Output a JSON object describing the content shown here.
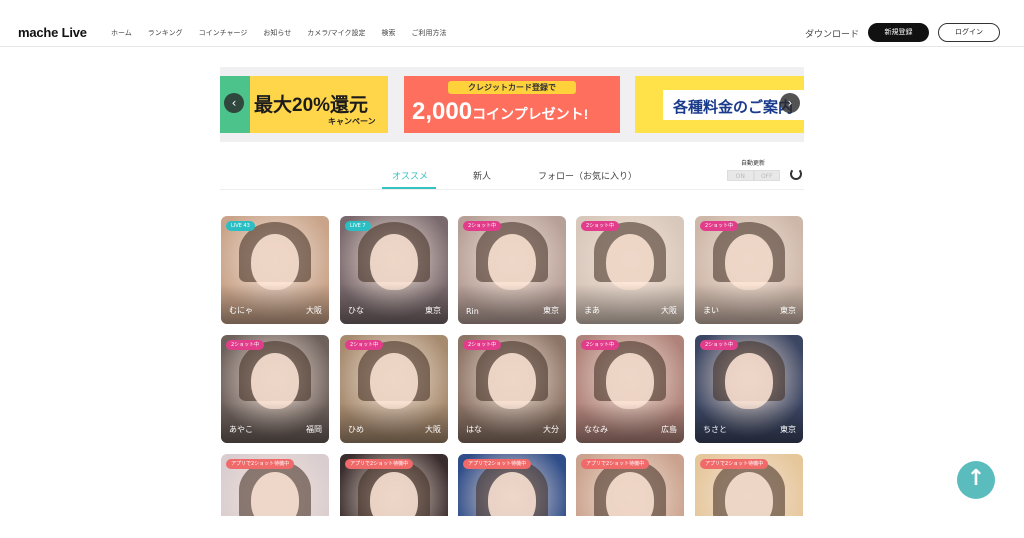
{
  "header": {
    "logo": "mache Live",
    "nav": [
      "ホーム",
      "ランキング",
      "コインチャージ",
      "お知らせ",
      "カメラ/マイク設定",
      "検索",
      "ご利用方法"
    ],
    "download": "ダウンロード",
    "register": "新規登録",
    "login": "ログイン"
  },
  "carousel": {
    "banner1": {
      "text": "最大20%還元",
      "sub": "キャンペーン"
    },
    "banner2": {
      "top": "クレジットカード登録で",
      "main": "2,000",
      "main_unit": "コイン",
      "main_rest": "プレゼント!"
    },
    "banner3": {
      "text": "各種料金のご案内"
    },
    "prev": "‹",
    "next": "›"
  },
  "tabs": [
    "オススメ",
    "新人",
    "フォロー（お気に入り）"
  ],
  "auto_refresh": {
    "label": "自動更新",
    "on": "ON",
    "off": "OFF"
  },
  "cards": [
    {
      "badge": "LIVE  43",
      "name": "むにゃ",
      "loc": "大阪",
      "badge_type": "teal",
      "color": "#c9a48a"
    },
    {
      "badge": "LIVE  7",
      "name": "ひな",
      "loc": "東京",
      "badge_type": "teal",
      "color": "#7a6a6e"
    },
    {
      "badge": "2ショット中",
      "name": "Rin",
      "loc": "東京",
      "badge_type": "pink",
      "color": "#b7a098"
    },
    {
      "badge": "2ショット中",
      "name": "まあ",
      "loc": "大阪",
      "badge_type": "pink",
      "color": "#d8c7bb"
    },
    {
      "badge": "2ショット中",
      "name": "まい",
      "loc": "東京",
      "badge_type": "pink",
      "color": "#cdb7a9"
    },
    {
      "badge": "2ショット中",
      "name": "あやこ",
      "loc": "福岡",
      "badge_type": "pink",
      "color": "#6e615c"
    },
    {
      "badge": "2ショット中",
      "name": "ひめ",
      "loc": "大阪",
      "badge_type": "pink",
      "color": "#a78b6f"
    },
    {
      "badge": "2ショット中",
      "name": "はな",
      "loc": "大分",
      "badge_type": "pink",
      "color": "#8c7466"
    },
    {
      "badge": "2ショット中",
      "name": "ななみ",
      "loc": "広島",
      "badge_type": "pink",
      "color": "#b0837a"
    },
    {
      "badge": "2ショット中",
      "name": "ちさと",
      "loc": "東京",
      "badge_type": "pink",
      "color": "#3b4663"
    },
    {
      "badge": "アプリで2ショット待機中",
      "name": "",
      "loc": "",
      "badge_type": "orange",
      "color": "#d9cdd0"
    },
    {
      "badge": "アプリで2ショット待機中",
      "name": "",
      "loc": "",
      "badge_type": "orange",
      "color": "#3a2d2d"
    },
    {
      "badge": "アプリで2ショット待機中",
      "name": "",
      "loc": "",
      "badge_type": "orange",
      "color": "#2e4d8a"
    },
    {
      "badge": "アプリで2ショット待機中",
      "name": "",
      "loc": "",
      "badge_type": "orange",
      "color": "#caa28d"
    },
    {
      "badge": "アプリで2ショット待機中",
      "name": "",
      "loc": "",
      "badge_type": "orange",
      "color": "#e6c79b"
    }
  ],
  "scroll_top": "↑",
  "colors": {
    "accent": "#36c2c0",
    "badge_pink": "#e23d8b",
    "badge_teal": "#2bbfc4"
  }
}
